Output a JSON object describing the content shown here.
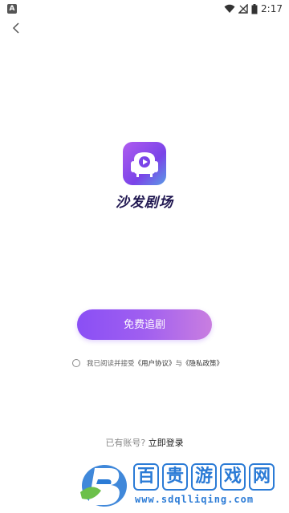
{
  "status_bar": {
    "app_badge": "A",
    "time": "2:17",
    "icons": [
      "wifi-icon",
      "signal-off-icon",
      "battery-icon"
    ]
  },
  "header": {
    "back_icon": "chevron-left-icon"
  },
  "brand": {
    "name": "沙发剧场",
    "logo_icon": "sofa-play-icon",
    "colors": {
      "logo_start": "#b05cf0",
      "logo_end": "#5a9be6",
      "text": "#1f1650"
    }
  },
  "primary_cta": {
    "label": "免费追剧",
    "colors": {
      "start": "#8a4ff5",
      "end": "#c97ee0"
    }
  },
  "agreement": {
    "prefix": "我已阅读并接受",
    "user_agreement": "《用户协议》",
    "conjunction": "与",
    "privacy_policy": "《隐私政策》"
  },
  "login": {
    "question": "已有账号?",
    "action": "立即登录"
  },
  "watermark": {
    "chars": [
      "百",
      "贵",
      "游",
      "戏",
      "网"
    ],
    "url": "www.sdqlliqing.com"
  }
}
